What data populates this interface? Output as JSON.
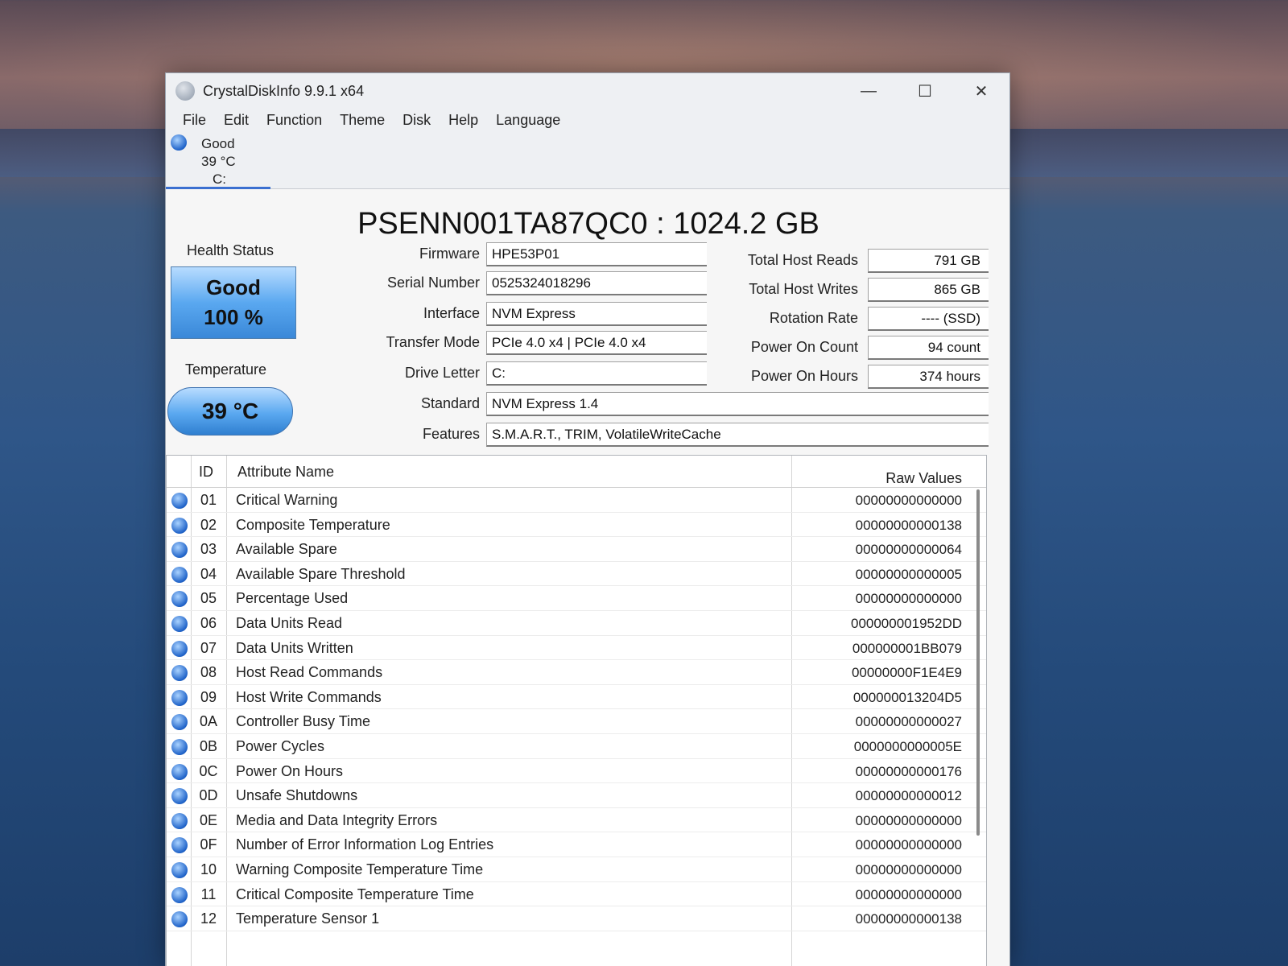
{
  "window": {
    "title": "CrystalDiskInfo 9.9.1 x64",
    "controls": {
      "minimize": "—",
      "maximize": "☐",
      "close": "✕"
    }
  },
  "menu": [
    "File",
    "Edit",
    "Function",
    "Theme",
    "Disk",
    "Help",
    "Language"
  ],
  "disk_tab": {
    "status": "Good",
    "temperature": "39 °C",
    "letter": "C:"
  },
  "model": "PSENN001TA87QC0 : 1024.2 GB",
  "health": {
    "label": "Health Status",
    "status": "Good",
    "percent": "100 %"
  },
  "temperature": {
    "label": "Temperature",
    "value": "39 °C"
  },
  "fields": {
    "firmware": {
      "label": "Firmware",
      "value": "HPE53P01"
    },
    "serial": {
      "label": "Serial Number",
      "value": "0525324018296"
    },
    "interface": {
      "label": "Interface",
      "value": "NVM Express"
    },
    "transfer": {
      "label": "Transfer Mode",
      "value": "PCIe 4.0 x4 | PCIe 4.0 x4"
    },
    "drive_letter": {
      "label": "Drive Letter",
      "value": "C:"
    },
    "standard": {
      "label": "Standard",
      "value": "NVM Express 1.4"
    },
    "features": {
      "label": "Features",
      "value": "S.M.A.R.T., TRIM, VolatileWriteCache"
    }
  },
  "stats": {
    "reads": {
      "label": "Total Host Reads",
      "value": "791 GB"
    },
    "writes": {
      "label": "Total Host Writes",
      "value": "865 GB"
    },
    "rotation": {
      "label": "Rotation Rate",
      "value": "---- (SSD)"
    },
    "power_count": {
      "label": "Power On Count",
      "value": "94 count"
    },
    "power_hours": {
      "label": "Power On Hours",
      "value": "374 hours"
    }
  },
  "smart": {
    "headers": {
      "id": "ID",
      "name": "Attribute Name",
      "raw": "Raw Values"
    },
    "rows": [
      {
        "id": "01",
        "name": "Critical Warning",
        "raw": "00000000000000"
      },
      {
        "id": "02",
        "name": "Composite Temperature",
        "raw": "00000000000138"
      },
      {
        "id": "03",
        "name": "Available Spare",
        "raw": "00000000000064"
      },
      {
        "id": "04",
        "name": "Available Spare Threshold",
        "raw": "00000000000005"
      },
      {
        "id": "05",
        "name": "Percentage Used",
        "raw": "00000000000000"
      },
      {
        "id": "06",
        "name": "Data Units Read",
        "raw": "000000001952DD"
      },
      {
        "id": "07",
        "name": "Data Units Written",
        "raw": "000000001BB079"
      },
      {
        "id": "08",
        "name": "Host Read Commands",
        "raw": "00000000F1E4E9"
      },
      {
        "id": "09",
        "name": "Host Write Commands",
        "raw": "000000013204D5"
      },
      {
        "id": "0A",
        "name": "Controller Busy Time",
        "raw": "00000000000027"
      },
      {
        "id": "0B",
        "name": "Power Cycles",
        "raw": "0000000000005E"
      },
      {
        "id": "0C",
        "name": "Power On Hours",
        "raw": "00000000000176"
      },
      {
        "id": "0D",
        "name": "Unsafe Shutdowns",
        "raw": "00000000000012"
      },
      {
        "id": "0E",
        "name": "Media and Data Integrity Errors",
        "raw": "00000000000000"
      },
      {
        "id": "0F",
        "name": "Number of Error Information Log Entries",
        "raw": "00000000000000"
      },
      {
        "id": "10",
        "name": "Warning Composite Temperature Time",
        "raw": "00000000000000"
      },
      {
        "id": "11",
        "name": "Critical Composite Temperature Time",
        "raw": "00000000000000"
      },
      {
        "id": "12",
        "name": "Temperature Sensor 1",
        "raw": "00000000000138"
      }
    ]
  }
}
